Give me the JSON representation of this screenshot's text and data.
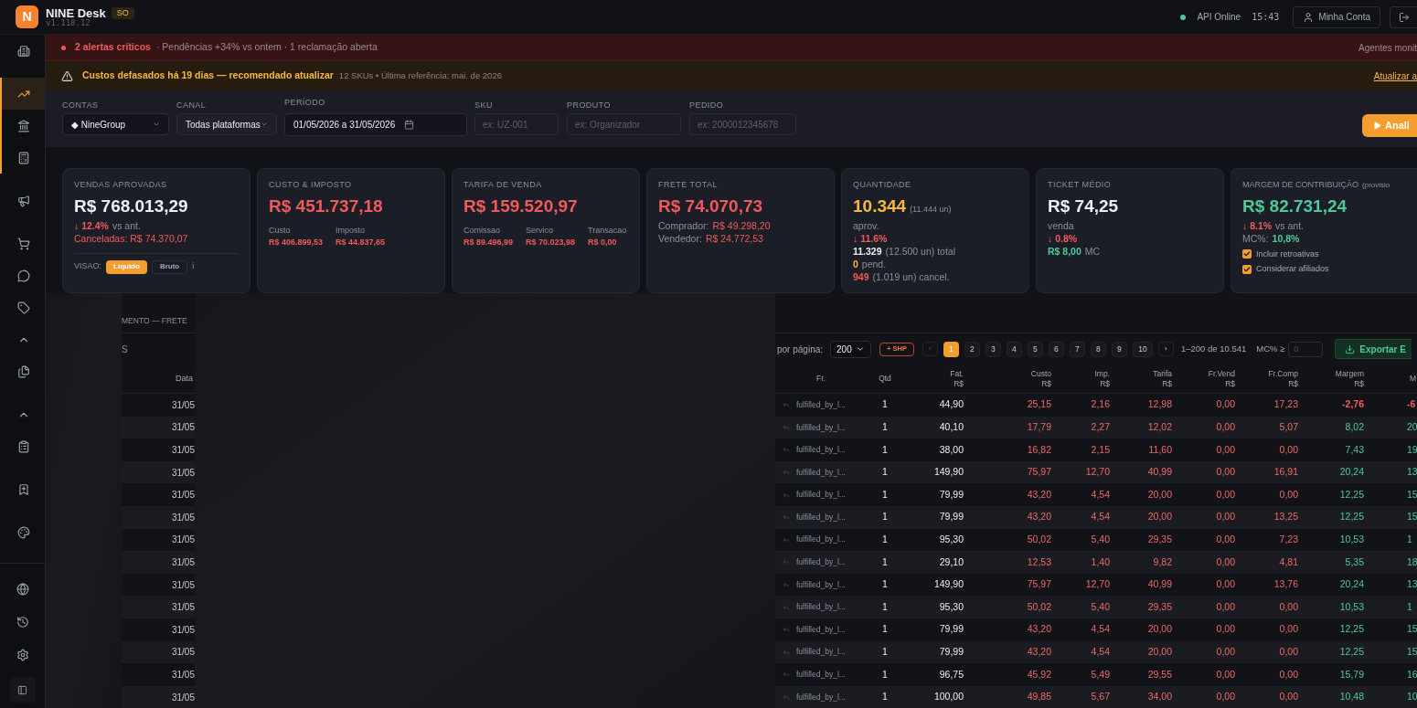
{
  "header": {
    "logo": "N",
    "app_name": "NINE Desk",
    "badge": "SO",
    "version": "v1.118.12",
    "api_status": "API Online",
    "api_online": true,
    "time": "15:43",
    "account_button": "Minha Conta"
  },
  "sidebar": {
    "groups": [
      {
        "highlighted": false,
        "items": [
          {
            "selected": false
          }
        ]
      },
      {
        "highlighted": true,
        "items": [
          {
            "selected": true
          },
          {
            "selected": false
          },
          {
            "selected": false
          }
        ]
      },
      {
        "highlighted": false,
        "items": [
          {
            "selected": false
          }
        ]
      },
      {
        "highlighted": false,
        "items": [
          {
            "selected": false
          },
          {
            "selected": false
          },
          {
            "selected": false
          },
          {
            "selected": false
          },
          {
            "selected": false
          }
        ]
      },
      {
        "highlighted": false,
        "items": [
          {
            "selected": false
          },
          {
            "selected": false
          }
        ]
      },
      {
        "highlighted": false,
        "items": [
          {
            "selected": false
          }
        ]
      },
      {
        "highlighted": false,
        "items": [
          {
            "selected": false
          }
        ]
      }
    ],
    "bottom_items": [
      {
        "selected": false
      },
      {
        "selected": false
      },
      {
        "selected": false
      }
    ]
  },
  "alerts": [
    {
      "kind": "critical",
      "title": "2 alertas críticos",
      "detail": "· Pendências +34% vs ontem · 1 reclamação aberta",
      "right": "Agentes monit"
    },
    {
      "kind": "warning",
      "title": "Custos defasados há 19 dias — recomendado atualizar",
      "detail": "12 SKUs • Última referência: mai. de 2026",
      "right": "Atualizar a"
    }
  ],
  "filters": [
    {
      "kind": "select",
      "label": "CONTAS",
      "value": "◆ NineGroup"
    },
    {
      "kind": "select",
      "label": "CANAL",
      "value": "Todas plataformas"
    },
    {
      "kind": "date",
      "label": "PERÍODO",
      "value": "01/05/2026 a 31/05/2026"
    },
    {
      "kind": "input",
      "label": "SKU",
      "placeholder": "ex: UZ-001"
    },
    {
      "kind": "input",
      "label": "PRODUTO",
      "placeholder": "ex: Organizador"
    },
    {
      "kind": "input",
      "label": "PEDIDO",
      "placeholder": "ex: 2000012345678"
    }
  ],
  "analyze_button": "Anali",
  "cards": [
    {
      "title": "VENDAS APROVADAS",
      "value": "R$ 768.013,29",
      "color": "#eceef2",
      "lines": [
        [
          {
            "text": "↓ 12.4%",
            "color": "#f05a5a",
            "bold": true
          },
          {
            "text": "vs ant.",
            "color": "#8b8f9c",
            "bold": false
          }
        ],
        [
          {
            "text": "Canceladas: R$ 74.370,07",
            "color": "#f05a5a",
            "bold": false
          }
        ]
      ],
      "view": {
        "label": "VISAO:",
        "options": [
          {
            "label": "Líquido",
            "selected": true
          },
          {
            "label": "Bruto",
            "selected": false
          }
        ],
        "info": "i"
      }
    },
    {
      "title": "CUSTO & IMPOSTO",
      "value": "R$ 451.737,18",
      "color": "#f05a5a",
      "columns": [
        {
          "label": "Custo",
          "value": "R$ 406.899,53"
        },
        {
          "label": "Imposto",
          "value": "R$ 44.837,65"
        }
      ]
    },
    {
      "title": "TARIFA DE VENDA",
      "value": "R$ 159.520,97",
      "color": "#f05a5a",
      "columns": [
        {
          "label": "Comissao",
          "value": "R$ 89.496,99"
        },
        {
          "label": "Servico",
          "value": "R$ 70.023,98"
        },
        {
          "label": "Transacao",
          "value": "R$ 0,00"
        }
      ]
    },
    {
      "title": "FRETE TOTAL",
      "value": "R$ 74.070,73",
      "color": "#f05a5a",
      "lines": [
        [
          {
            "text": "Comprador:",
            "color": "#8b8f9c",
            "bold": false
          },
          {
            "text": "R$ 49.298,20",
            "color": "#f05a5a",
            "bold": false
          }
        ],
        [
          {
            "text": "Vendedor:",
            "color": "#8b8f9c",
            "bold": false
          },
          {
            "text": "R$ 24.772,53",
            "color": "#f05a5a",
            "bold": false
          }
        ]
      ]
    },
    {
      "title": "QUANTIDADE",
      "value": "10.344",
      "value_suffix": "(11.444 un)",
      "color": "#f5b942",
      "lines": [
        [
          {
            "text": "aprov.",
            "color": "#8b8f9c",
            "bold": false
          }
        ],
        [
          {
            "text": "↓ 11.6%",
            "color": "#f05a5a",
            "bold": true
          }
        ],
        [
          {
            "text": "11.329",
            "color": "#eceef2",
            "bold": true
          },
          {
            "text": "(12.500 un) total",
            "color": "#8b8f9c",
            "bold": false
          }
        ],
        [
          {
            "text": "0",
            "color": "#f5b942",
            "bold": true
          },
          {
            "text": "pend.",
            "color": "#8b8f9c",
            "bold": false
          }
        ],
        [
          {
            "text": "949",
            "color": "#f05a5a",
            "bold": true
          },
          {
            "text": "(1.019 un) cancel.",
            "color": "#8b8f9c",
            "bold": false
          }
        ]
      ]
    },
    {
      "title": "TICKET MÉDIO",
      "value": "R$ 74,25",
      "color": "#eceef2",
      "lines": [
        [
          {
            "text": "venda",
            "color": "#8b8f9c",
            "bold": false
          }
        ],
        [
          {
            "text": "↓ 0.8%",
            "color": "#f05a5a",
            "bold": true
          }
        ],
        [
          {
            "text": "R$ 8,00",
            "color": "#4fc99a",
            "bold": true
          },
          {
            "text": "MC",
            "color": "#8b8f9c",
            "bold": false
          }
        ]
      ]
    },
    {
      "title": "MARGEM DE CONTRIBUIÇÃO",
      "title_note": "(provisio",
      "value": "R$ 82.731,24",
      "color": "#4fc99a",
      "lines": [
        [
          {
            "text": "↓ 8.1%",
            "color": "#f05a5a",
            "bold": true
          },
          {
            "text": "vs ant.",
            "color": "#8b8f9c",
            "bold": false
          }
        ],
        [
          {
            "text": "MC%:",
            "color": "#8b8f9c",
            "bold": false
          },
          {
            "text": "10,8%",
            "color": "#4fc99a",
            "bold": true
          }
        ]
      ],
      "checkboxes": [
        {
          "label": "Incluir retroativas",
          "checked": true
        },
        {
          "label": "Considerar afiliados",
          "checked": true
        }
      ]
    }
  ],
  "table": {
    "section_title": "MENTO — FRETE",
    "toolbar_fragment": "S",
    "per_page_label": "por página:",
    "per_page": "200",
    "shp_button": "+ SHP",
    "prev": "‹",
    "next": "›",
    "pages": [
      {
        "label": "1",
        "selected": true
      },
      {
        "label": "2",
        "selected": false
      },
      {
        "label": "3",
        "selected": false
      },
      {
        "label": "4",
        "selected": false
      },
      {
        "label": "5",
        "selected": false
      },
      {
        "label": "6",
        "selected": false
      },
      {
        "label": "7",
        "selected": false
      },
      {
        "label": "8",
        "selected": false
      },
      {
        "label": "9",
        "selected": false
      },
      {
        "label": "10",
        "selected": false
      }
    ],
    "range": "1–200 de 10.541",
    "mc_filter_label": "MC% ≥",
    "mc_filter_placeholder": "0",
    "export_button": "Exportar E",
    "date_column": "Data",
    "columns": [
      {
        "label": "Fr."
      },
      {
        "label": "Qtd"
      },
      {
        "label": "Fat.",
        "unit": "R$"
      },
      {
        "label": "Custo",
        "unit": "R$"
      },
      {
        "label": "Imp.",
        "unit": "R$"
      },
      {
        "label": "Tarifa",
        "unit": "R$"
      },
      {
        "label": "Fr.Vend",
        "unit": "R$"
      },
      {
        "label": "Fr.Comp",
        "unit": "R$"
      },
      {
        "label": "Margem",
        "unit": "R$"
      },
      {
        "label": "M"
      }
    ],
    "rows": [
      {
        "date": "31/05",
        "negative": true,
        "cells": [
          "fulfilled_by_l...",
          "1",
          "44,90",
          "25,15",
          "2,16",
          "12,98",
          "0,00",
          "17,23",
          "-2,76",
          "-6"
        ]
      },
      {
        "date": "31/05",
        "negative": false,
        "cells": [
          "fulfilled_by_l...",
          "1",
          "40,10",
          "17,79",
          "2,27",
          "12,02",
          "0,00",
          "5,07",
          "8,02",
          "20"
        ]
      },
      {
        "date": "31/05",
        "negative": false,
        "cells": [
          "fulfilled_by_l...",
          "1",
          "38,00",
          "16,82",
          "2,15",
          "11,60",
          "0,00",
          "0,00",
          "7,43",
          "19"
        ]
      },
      {
        "date": "31/05",
        "negative": false,
        "cells": [
          "fulfilled_by_l...",
          "1",
          "149,90",
          "75,97",
          "12,70",
          "40,99",
          "0,00",
          "16,91",
          "20,24",
          "13"
        ]
      },
      {
        "date": "31/05",
        "negative": false,
        "cells": [
          "fulfilled_by_l...",
          "1",
          "79,99",
          "43,20",
          "4,54",
          "20,00",
          "0,00",
          "0,00",
          "12,25",
          "15"
        ]
      },
      {
        "date": "31/05",
        "negative": false,
        "cells": [
          "fulfilled_by_l...",
          "1",
          "79,99",
          "43,20",
          "4,54",
          "20,00",
          "0,00",
          "13,25",
          "12,25",
          "15"
        ]
      },
      {
        "date": "31/05",
        "negative": false,
        "cells": [
          "fulfilled_by_l...",
          "1",
          "95,30",
          "50,02",
          "5,40",
          "29,35",
          "0,00",
          "7,23",
          "10,53",
          "1"
        ]
      },
      {
        "date": "31/05",
        "negative": false,
        "cells": [
          "fulfilled_by_l...",
          "1",
          "29,10",
          "12,53",
          "1,40",
          "9,82",
          "0,00",
          "4,81",
          "5,35",
          "18"
        ]
      },
      {
        "date": "31/05",
        "negative": false,
        "cells": [
          "fulfilled_by_l...",
          "1",
          "149,90",
          "75,97",
          "12,70",
          "40,99",
          "0,00",
          "13,76",
          "20,24",
          "13"
        ]
      },
      {
        "date": "31/05",
        "negative": false,
        "cells": [
          "fulfilled_by_l...",
          "1",
          "95,30",
          "50,02",
          "5,40",
          "29,35",
          "0,00",
          "0,00",
          "10,53",
          "1"
        ]
      },
      {
        "date": "31/05",
        "negative": false,
        "cells": [
          "fulfilled_by_l...",
          "1",
          "79,99",
          "43,20",
          "4,54",
          "20,00",
          "0,00",
          "0,00",
          "12,25",
          "15"
        ]
      },
      {
        "date": "31/05",
        "negative": false,
        "cells": [
          "fulfilled_by_l...",
          "1",
          "79,99",
          "43,20",
          "4,54",
          "20,00",
          "0,00",
          "0,00",
          "12,25",
          "15"
        ]
      },
      {
        "date": "31/05",
        "negative": false,
        "cells": [
          "fulfilled_by_l...",
          "1",
          "96,75",
          "45,92",
          "5,49",
          "29,55",
          "0,00",
          "0,00",
          "15,79",
          "16"
        ]
      },
      {
        "date": "31/05",
        "negative": false,
        "cells": [
          "fulfilled_by_l...",
          "1",
          "100,00",
          "49,85",
          "5,67",
          "34,00",
          "0,00",
          "0,00",
          "10,48",
          "10"
        ]
      }
    ]
  }
}
